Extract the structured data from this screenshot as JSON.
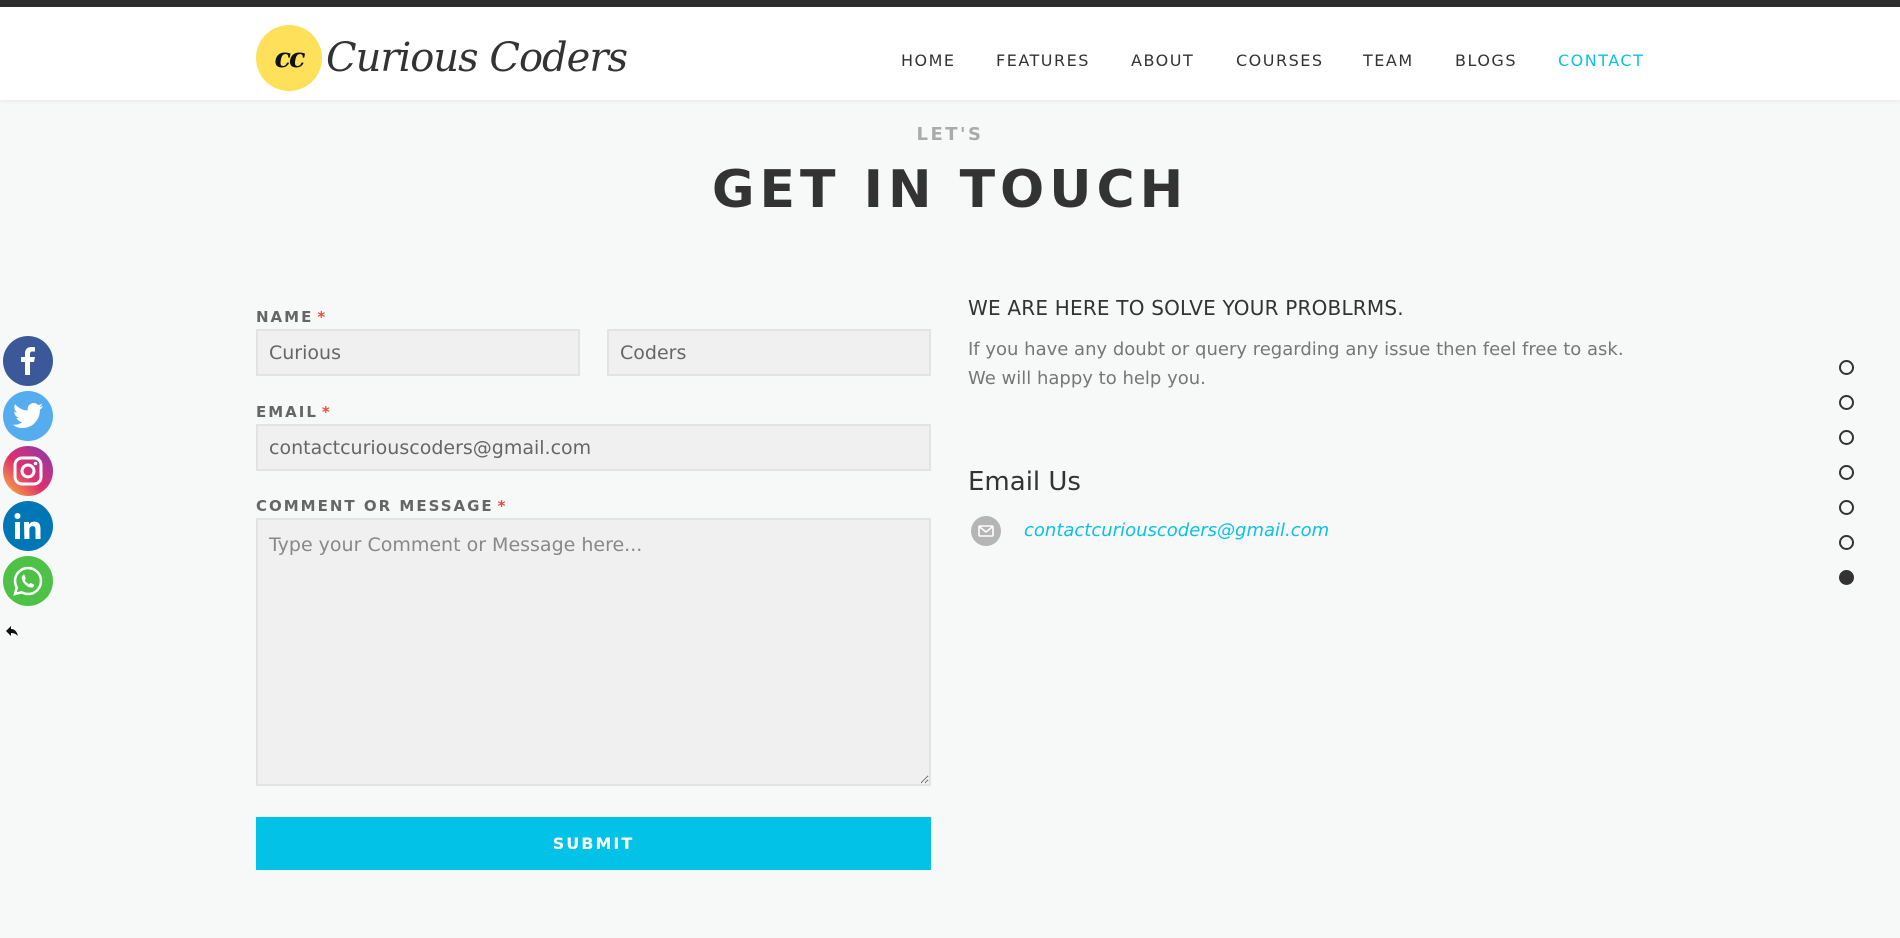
{
  "header": {
    "logo_badge": "cc",
    "logo_text": "Curious Coders",
    "nav": [
      {
        "label": "HOME",
        "active": false
      },
      {
        "label": "FEATURES",
        "active": false
      },
      {
        "label": "ABOUT",
        "active": false
      },
      {
        "label": "COURSES",
        "active": false
      },
      {
        "label": "TEAM",
        "active": false
      },
      {
        "label": "BLOGS",
        "active": false
      },
      {
        "label": "CONTACT",
        "active": true
      }
    ]
  },
  "section": {
    "eyebrow": "LET'S",
    "title": "GET IN TOUCH"
  },
  "form": {
    "name_label": "NAME",
    "first_name_value": "Curious",
    "last_name_value": "Coders",
    "email_label": "EMAIL",
    "email_value": "contactcuriouscoders@gmail.com",
    "message_label": "COMMENT OR MESSAGE",
    "message_placeholder": "Type your Comment or Message here...",
    "required_mark": "*",
    "submit_label": "SUBMIT"
  },
  "info": {
    "heading": "WE ARE HERE TO SOLVE YOUR PROBLRMS.",
    "text": "If you have any doubt or query regarding any issue then feel free to ask. We will happy to help you.",
    "email_title": "Email Us",
    "email_link": "contactcuriouscoders@gmail.com"
  },
  "social": [
    {
      "name": "facebook-icon",
      "color": "#3b5998"
    },
    {
      "name": "twitter-icon",
      "color": "#55acee"
    },
    {
      "name": "instagram-icon",
      "color": "#c13584"
    },
    {
      "name": "linkedin-icon",
      "color": "#0077b5"
    },
    {
      "name": "whatsapp-icon",
      "color": "#4dc247"
    }
  ],
  "section_dots": {
    "count": 7,
    "active_index": 6
  },
  "colors": {
    "accent": "#0cc0e7",
    "submit_bg": "#03c2e8",
    "logo_badge": "#fee05b",
    "required": "#e84c3d"
  }
}
